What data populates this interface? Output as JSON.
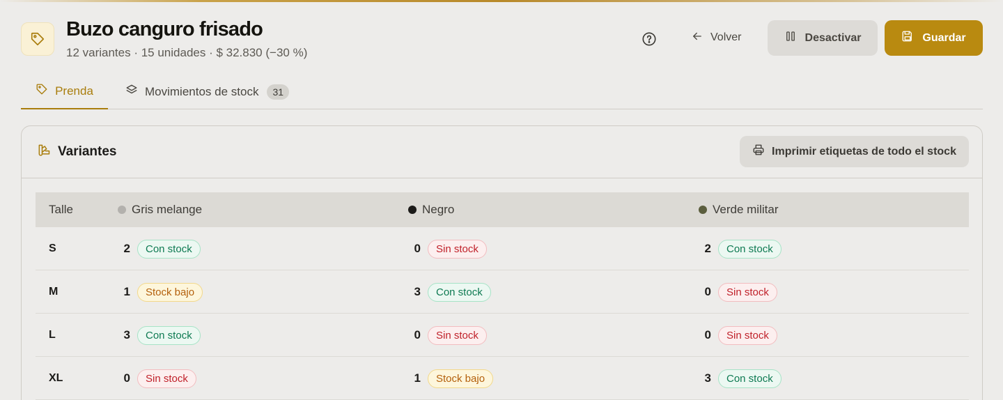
{
  "colors": {
    "accent": "#b98a10",
    "accent_text": "#a97d0c",
    "in_stock": "#0e7a52",
    "out_of_stock": "#c0212a",
    "low_stock": "#b4600c"
  },
  "header": {
    "icon": "tag-icon",
    "title": "Buzo canguro frisado",
    "subtitle": "12 variantes · 15 unidades · $ 32.830 (−30 %)",
    "help_icon": "help-circle-icon",
    "back_label": "Volver",
    "deactivate_label": "Desactivar",
    "save_label": "Guardar"
  },
  "tabs": [
    {
      "label": "Prenda",
      "icon": "tag-icon",
      "active": true
    },
    {
      "label": "Movimientos de stock",
      "icon": "layers-icon",
      "count": "31"
    }
  ],
  "variants": {
    "title": "Variantes",
    "icon": "swatch-icon",
    "print_label": "Imprimir etiquetas de todo el stock",
    "columns": [
      {
        "label": "Talle"
      },
      {
        "label": "Gris melange",
        "color": "#b3b1ad"
      },
      {
        "label": "Negro",
        "color": "#1c1b19"
      },
      {
        "label": "Verde militar",
        "color": "#5b5e3e"
      }
    ],
    "rows": [
      {
        "size": "S",
        "cells": [
          {
            "qty": "2",
            "status": "Con stock"
          },
          {
            "qty": "0",
            "status": "Sin stock"
          },
          {
            "qty": "2",
            "status": "Con stock"
          }
        ]
      },
      {
        "size": "M",
        "cells": [
          {
            "qty": "1",
            "status": "Stock bajo"
          },
          {
            "qty": "3",
            "status": "Con stock"
          },
          {
            "qty": "0",
            "status": "Sin stock"
          }
        ]
      },
      {
        "size": "L",
        "cells": [
          {
            "qty": "3",
            "status": "Con stock"
          },
          {
            "qty": "0",
            "status": "Sin stock"
          },
          {
            "qty": "0",
            "status": "Sin stock"
          }
        ]
      },
      {
        "size": "XL",
        "cells": [
          {
            "qty": "0",
            "status": "Sin stock"
          },
          {
            "qty": "1",
            "status": "Stock bajo"
          },
          {
            "qty": "3",
            "status": "Con stock"
          }
        ]
      }
    ]
  }
}
